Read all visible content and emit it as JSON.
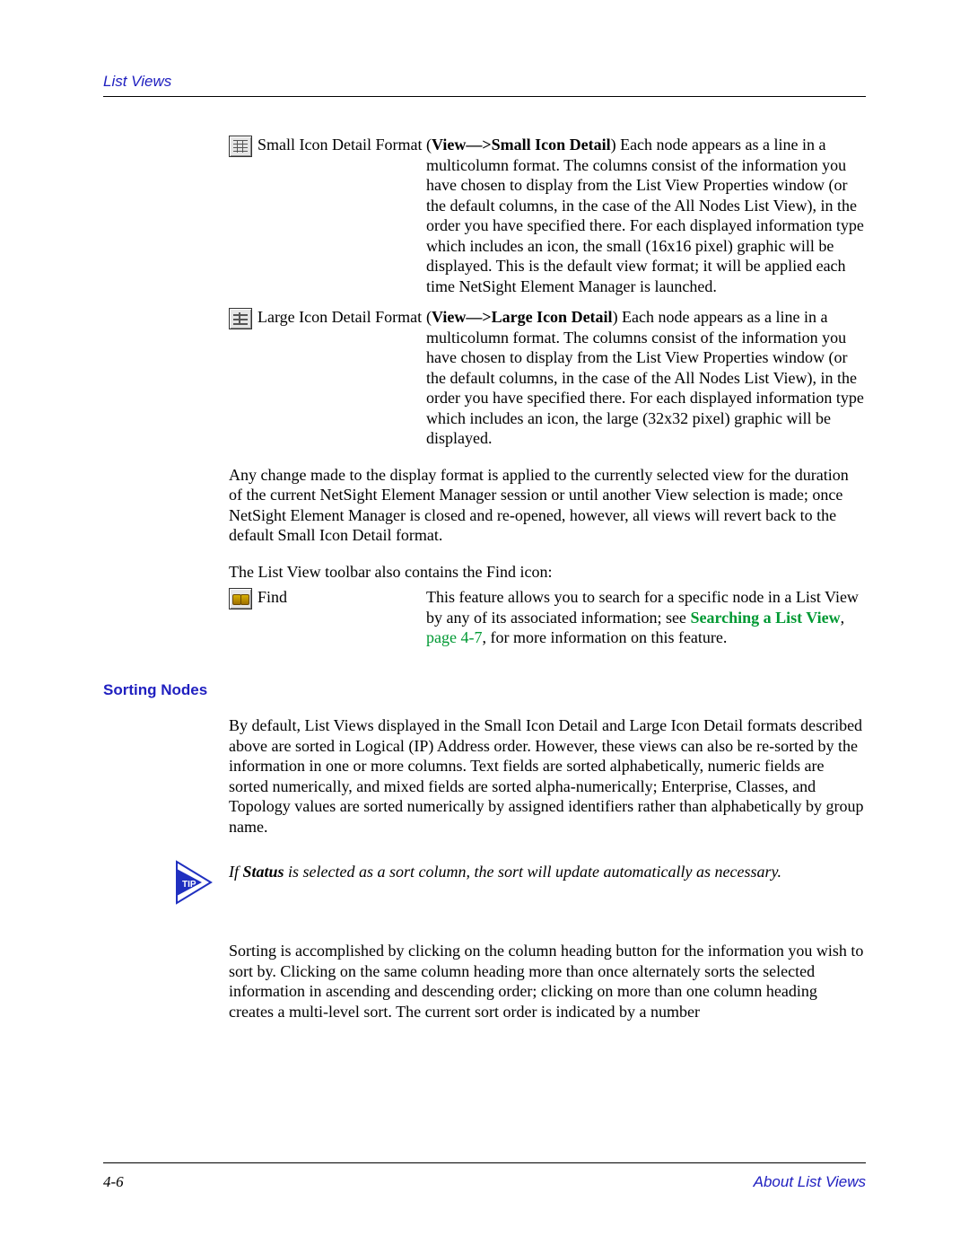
{
  "header": {
    "running_head": "List Views"
  },
  "formats": {
    "small": {
      "label": "Small Icon Detail Format",
      "menu_bold": "View—>Small Icon Detail",
      "desc_after": ") Each node appears as a line in a multicolumn format. The columns consist of the information you have chosen to display from the List View Properties window (or the default columns, in the case of the All Nodes List View), in the order you have specified there. For each displayed information type which includes an icon, the small (16x16 pixel) graphic will be displayed. This is the default view format; it will be applied each time NetSight Element Manager is launched."
    },
    "large": {
      "label": "Large Icon Detail Format",
      "menu_bold": "View—>Large Icon Detail",
      "desc_after": ") Each node appears as a line in a multicolumn format. The columns consist of the information you have chosen to display from the List View Properties window (or the default columns, in the case of the All Nodes List View), in the order you have specified there. For each displayed information type which includes an icon, the large (32x32 pixel) graphic will be displayed."
    }
  },
  "paragraphs": {
    "format_change": "Any change made to the display format is applied to the currently selected view for the duration of the current NetSight Element Manager session or until another View selection is made; once NetSight Element Manager is closed and re-opened, however, all views will revert back to the default Small Icon Detail format.",
    "find_intro": "The List View toolbar also contains the Find icon:"
  },
  "find": {
    "label": "Find",
    "desc_before": "This feature allows you to search for a specific node in a List View by any of its associated information; see ",
    "xref_text": "Searching a List View",
    "xref_sep": ", ",
    "xref_page": "page 4-7",
    "desc_after": ", for more information on this feature."
  },
  "sorting": {
    "heading": "Sorting Nodes",
    "para1": "By default, List Views displayed in the Small Icon Detail and Large Icon Detail formats described above are sorted in Logical (IP) Address order. However, these views can also be re-sorted by the information in one or more columns. Text fields are sorted alphabetically, numeric fields are sorted numerically, and mixed fields are sorted alpha-numerically; Enterprise, Classes, and Topology values are sorted numerically by assigned identifiers rather than alphabetically by group name.",
    "tip_label": "TIP",
    "tip_prefix": "If ",
    "tip_bold": "Status",
    "tip_rest": " is selected as a sort column, the sort will update automatically as necessary.",
    "para2": "Sorting is accomplished by clicking on the column heading button for the information you wish to sort by. Clicking on the same column heading more than once alternately sorts the selected information in ascending and descending order; clicking on more than one column heading creates a multi-level sort. The current sort order is indicated by a number"
  },
  "footer": {
    "page_number": "4-6",
    "section": "About List Views"
  }
}
